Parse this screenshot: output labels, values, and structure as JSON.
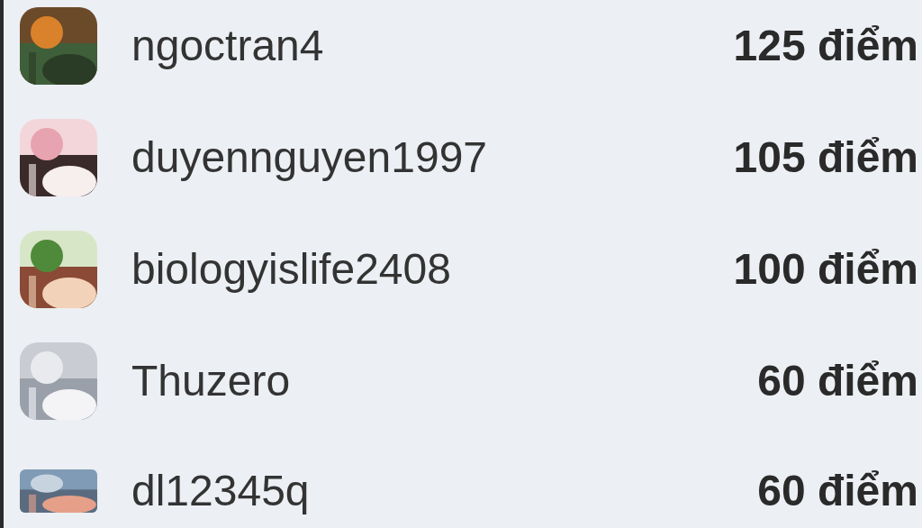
{
  "leaderboard": [
    {
      "username": "ngoctran4",
      "points": "125 điểm"
    },
    {
      "username": "duyennguyen1997",
      "points": "105 điểm"
    },
    {
      "username": "biologyislife2408",
      "points": "100 điểm"
    },
    {
      "username": "Thuzero",
      "points": "60 điểm"
    },
    {
      "username": "dl12345q",
      "points": "60 điểm"
    }
  ]
}
